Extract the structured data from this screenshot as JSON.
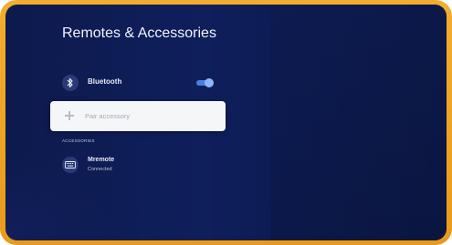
{
  "page": {
    "title": "Remotes & Accessories"
  },
  "bluetooth": {
    "label": "Bluetooth",
    "icon": "bluetooth-icon",
    "enabled": true
  },
  "pair": {
    "label": "Pair accessory",
    "icon": "plus-icon"
  },
  "accessories": {
    "header": "ACCESSORIES",
    "items": [
      {
        "name": "Mremote",
        "status": "Connected",
        "icon": "keyboard-icon"
      }
    ]
  },
  "colors": {
    "frame": "#f0a82a",
    "background": "#0f1f5c",
    "toggle_accent": "#4b7fe0",
    "card": "#f5f6f8"
  }
}
